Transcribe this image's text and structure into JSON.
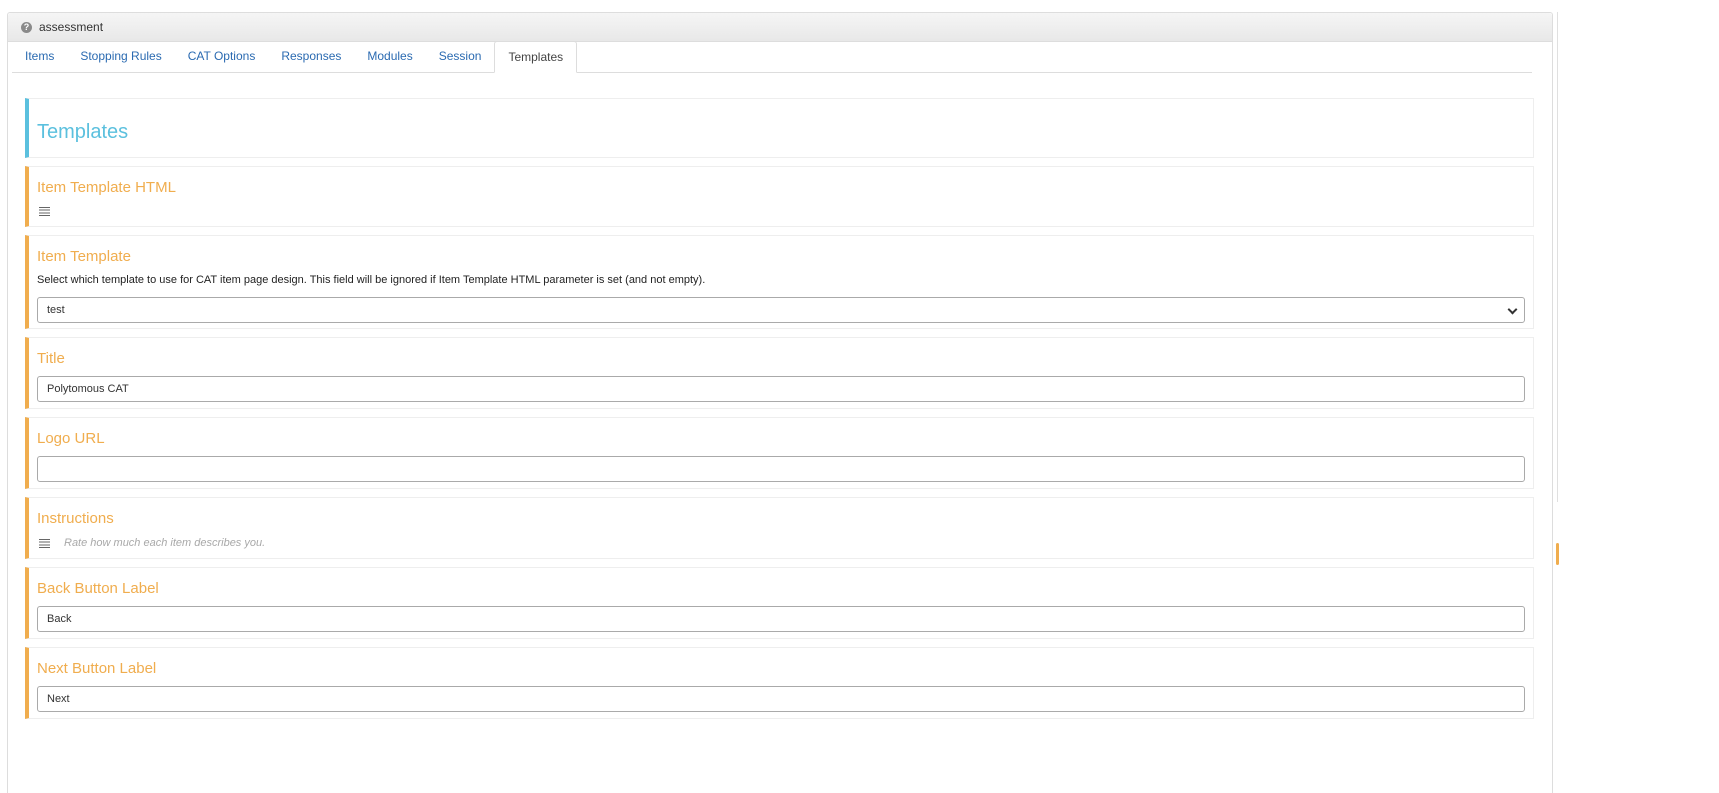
{
  "panel": {
    "title": "assessment",
    "help_icon": "question-circle-icon"
  },
  "tabs": [
    {
      "label": "Items",
      "active": false
    },
    {
      "label": "Stopping Rules",
      "active": false
    },
    {
      "label": "CAT Options",
      "active": false
    },
    {
      "label": "Responses",
      "active": false
    },
    {
      "label": "Modules",
      "active": false
    },
    {
      "label": "Session",
      "active": false
    },
    {
      "label": "Templates",
      "active": true
    }
  ],
  "sections": {
    "header": {
      "title": "Templates"
    },
    "item_template_html": {
      "title": "Item Template HTML",
      "icon": "align-justify-icon"
    },
    "item_template": {
      "title": "Item Template",
      "description": "Select which template to use for CAT item page design. This field will be ignored if Item Template HTML parameter is set (and not empty).",
      "selected": "test"
    },
    "title": {
      "title": "Title",
      "value": "Polytomous CAT"
    },
    "logo_url": {
      "title": "Logo URL",
      "value": ""
    },
    "instructions": {
      "title": "Instructions",
      "icon": "align-justify-icon",
      "value": "Rate how much each item describes you."
    },
    "back_button_label": {
      "title": "Back Button Label",
      "value": "Back"
    },
    "next_button_label": {
      "title": "Next Button Label",
      "value": "Next"
    }
  },
  "colors": {
    "accent_orange": "#f0ad4e",
    "accent_blue": "#5bc0de",
    "link_blue": "#2a6ab1"
  }
}
